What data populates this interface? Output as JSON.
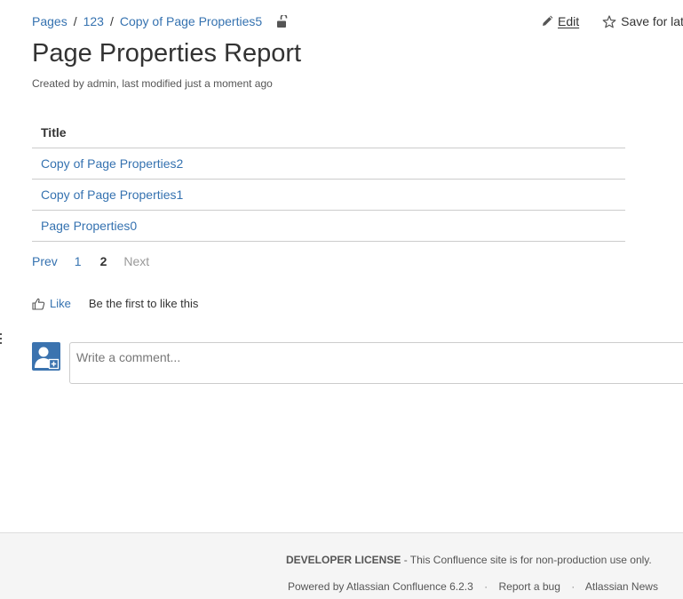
{
  "breadcrumb": {
    "items": [
      "Pages",
      "123",
      "Copy of Page Properties5"
    ],
    "separator": "/"
  },
  "actions": {
    "edit_label": "Edit",
    "save_label": "Save for later"
  },
  "page": {
    "title": "Page Properties Report",
    "meta": "Created by admin, last modified just a moment ago"
  },
  "report": {
    "column_header": "Title",
    "rows": [
      "Copy of Page Properties2",
      "Copy of Page Properties1",
      "Page Properties0"
    ]
  },
  "pagination": {
    "prev": "Prev",
    "pages": [
      "1",
      "2"
    ],
    "current_page": "2",
    "next": "Next"
  },
  "like": {
    "label": "Like",
    "summary": "Be the first to like this"
  },
  "comment": {
    "placeholder": "Write a comment..."
  },
  "footer": {
    "license_bold": "DEVELOPER LICENSE",
    "license_text": " - This Confluence site is for non-production use only.",
    "links": [
      "Powered by Atlassian Confluence 6.2.3",
      "Report a bug",
      "Atlassian News"
    ]
  },
  "colors": {
    "link": "#3572b0",
    "text": "#333333",
    "avatar": "#3b73af",
    "footer_bg": "#f5f5f5"
  },
  "icons": [
    "lock-open-icon",
    "pencil-icon",
    "star-icon",
    "thumbs-up-icon",
    "user-avatar-icon"
  ]
}
